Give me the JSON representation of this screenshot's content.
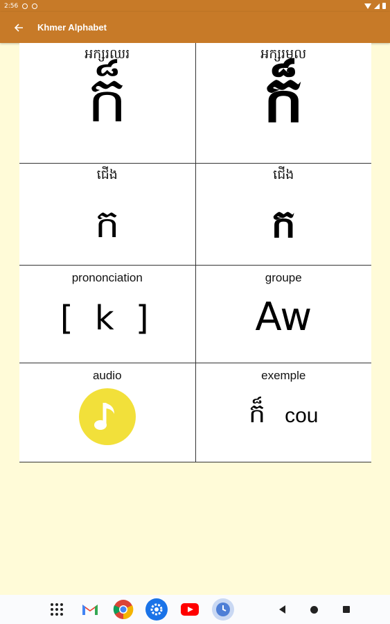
{
  "status_bar": {
    "time": "2:56"
  },
  "app_bar": {
    "title": "Khmer Alphabet",
    "back_icon": "arrow-left-icon"
  },
  "card": {
    "row1": {
      "left_label": "អក្សរឈរ",
      "left_glyph": "ក៏",
      "right_label": "អក្សរមូល",
      "right_glyph": "ក៏"
    },
    "row2": {
      "left_label": "ជើង",
      "left_glyph": "ក",
      "right_label": "ជើង",
      "right_glyph": "ក"
    },
    "row3": {
      "left_label": "prononciation",
      "left_value": "[ k ]",
      "right_label": "groupe",
      "right_value": "Aw"
    },
    "row4": {
      "left_label": "audio",
      "audio_icon": "music-note-icon",
      "audio_color": "#f2e03a",
      "right_label": "exemple",
      "example_khmer": "ក៏",
      "example_french": "cou"
    }
  },
  "nav_bar": {
    "apps": [
      "apps-grid-icon",
      "gmail-icon",
      "chrome-icon",
      "settings-icon",
      "youtube-icon",
      "clock-icon"
    ]
  },
  "colors": {
    "app_bar": "#c77a28",
    "background": "#fffbd8"
  }
}
